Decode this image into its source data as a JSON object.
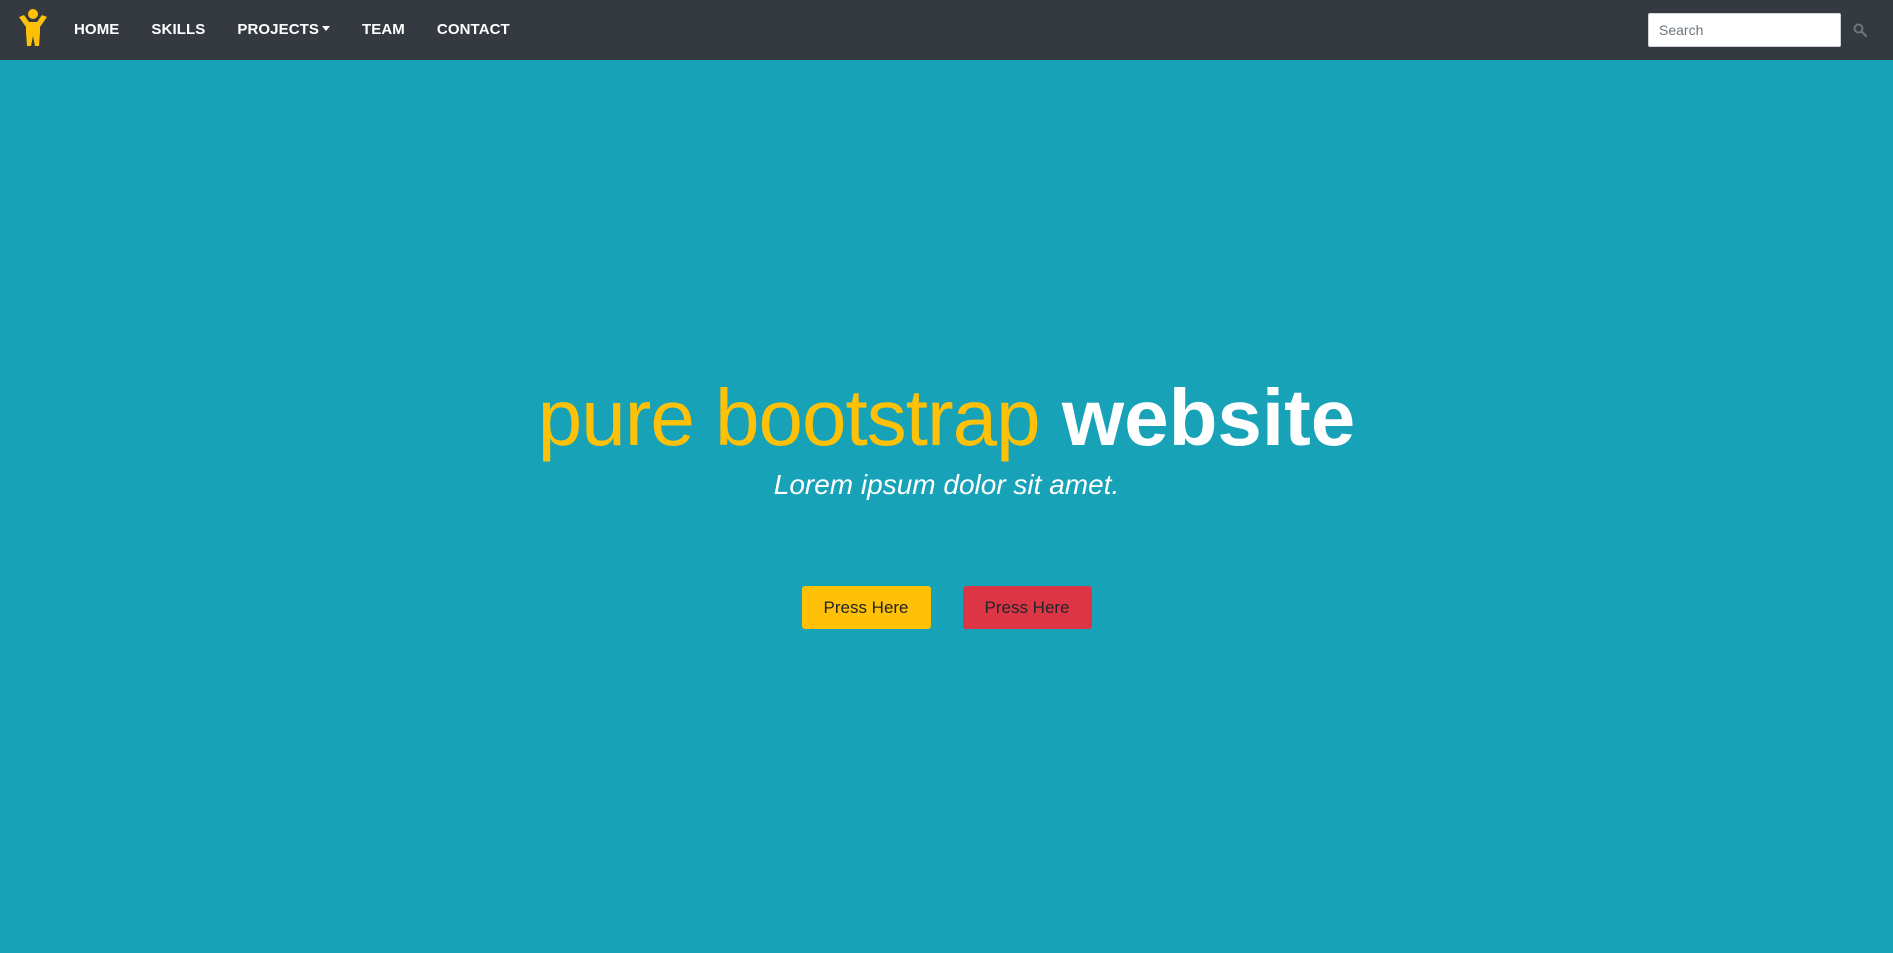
{
  "navbar": {
    "brand_icon": "accessibility-person-icon",
    "brand_color": "#ffc107",
    "background": "#343a40",
    "links": [
      {
        "label": "HOME"
      },
      {
        "label": "SKILLS"
      },
      {
        "label": "PROJECTS",
        "has_dropdown": true
      },
      {
        "label": "TEAM"
      },
      {
        "label": "CONTACT"
      }
    ],
    "search": {
      "placeholder": "Search",
      "value": "",
      "button_icon": "search-icon"
    }
  },
  "hero": {
    "background": "#17a2b8",
    "title_light": "pure bootstrap",
    "title_bold": "website",
    "title_light_color": "#ffc107",
    "title_bold_color": "#ffffff",
    "subtitle": "Lorem ipsum dolor sit amet.",
    "buttons": [
      {
        "label": "Press Here",
        "color": "#ffc107"
      },
      {
        "label": "Press Here",
        "color": "#dc3545"
      }
    ]
  }
}
